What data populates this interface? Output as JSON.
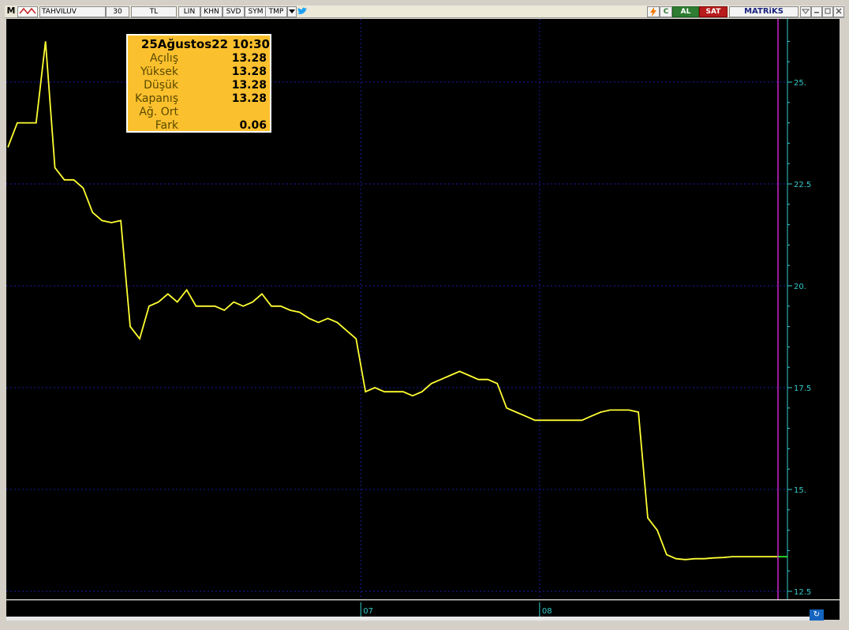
{
  "toolbar": {
    "m_label": "M",
    "symbol": "TAHVILUV",
    "period": "30",
    "currency": "TL",
    "scale": "LIN",
    "khn": "KHN",
    "svd": "SVD",
    "sym": "SYM",
    "tmp": "TMP",
    "c_label": "C",
    "buy_label": "AL",
    "sell_label": "SAT",
    "brand": "MATRiKS",
    "icons": [
      "menu-m-icon",
      "chart-settings-icon",
      "dropdown-arrow-icon",
      "twitter-icon",
      "lightning-icon",
      "minimize-icon",
      "restore-icon",
      "close-icon"
    ]
  },
  "infobox": {
    "header": "25Ağustos22 10:30",
    "rows": [
      {
        "label": "Açılış",
        "value": "13.28"
      },
      {
        "label": "Yüksek",
        "value": "13.28"
      },
      {
        "label": "Düşük",
        "value": "13.28"
      },
      {
        "label": "Kapanış",
        "value": "13.28"
      },
      {
        "label": "Ağ. Ort",
        "value": ""
      },
      {
        "label": "Fark",
        "value": "0.06"
      }
    ]
  },
  "chart_data": {
    "type": "line",
    "title": "",
    "xlabel": "",
    "ylabel": "",
    "ylim": [
      12.5,
      26.0
    ],
    "y_ticks": [
      12.5,
      15,
      17.5,
      20,
      22.5,
      25
    ],
    "y_tick_labels": [
      "12.5",
      "15.",
      "17.5",
      "20.",
      "22.5",
      "25."
    ],
    "x_tick_labels": [
      "07",
      "08"
    ],
    "x_tick_positions": [
      37.5,
      56.5
    ],
    "series": [
      {
        "name": "",
        "color": "#ffff33",
        "x": [
          0,
          1,
          2,
          3,
          4,
          5,
          6,
          7,
          8,
          9,
          10,
          11,
          12,
          13,
          14,
          15,
          16,
          17,
          18,
          19,
          20,
          21,
          22,
          23,
          24,
          25,
          26,
          27,
          28,
          29,
          30,
          31,
          32,
          33,
          34,
          35,
          36,
          37,
          38,
          39,
          40,
          41,
          42,
          43,
          44,
          45,
          46,
          47,
          48,
          49,
          50,
          51,
          52,
          53,
          54,
          55,
          56,
          57,
          58,
          59,
          60,
          61,
          62,
          63,
          64,
          65,
          66,
          67,
          68,
          69,
          70,
          71,
          72,
          73,
          74,
          75,
          76,
          77,
          78,
          79,
          80,
          81,
          82
        ],
        "values": [
          23.4,
          24.0,
          24.0,
          24.0,
          26.0,
          22.9,
          22.6,
          22.6,
          22.4,
          21.8,
          21.6,
          21.55,
          21.6,
          19.0,
          18.7,
          19.5,
          19.6,
          19.8,
          19.6,
          19.9,
          19.5,
          19.5,
          19.5,
          19.4,
          19.6,
          19.5,
          19.6,
          19.8,
          19.5,
          19.5,
          19.4,
          19.35,
          19.2,
          19.1,
          19.2,
          19.1,
          18.9,
          18.7,
          17.4,
          17.5,
          17.4,
          17.4,
          17.4,
          17.3,
          17.4,
          17.6,
          17.7,
          17.8,
          17.9,
          17.8,
          17.7,
          17.7,
          17.6,
          17.0,
          16.9,
          16.8,
          16.7,
          16.7,
          16.7,
          16.7,
          16.7,
          16.7,
          16.8,
          16.9,
          16.95,
          16.95,
          16.95,
          16.9,
          14.3,
          14.0,
          13.4,
          13.3,
          13.28,
          13.3,
          13.3,
          13.32,
          13.33,
          13.35,
          13.35,
          13.35,
          13.35,
          13.35,
          13.35
        ]
      }
    ],
    "cursor_x": 82,
    "cursor_color": "#c020c0",
    "last_value_marker_color": "#33ff33",
    "grid": true,
    "grid_color": "#1a1aa0",
    "axis_label_color": "#33cccc"
  }
}
